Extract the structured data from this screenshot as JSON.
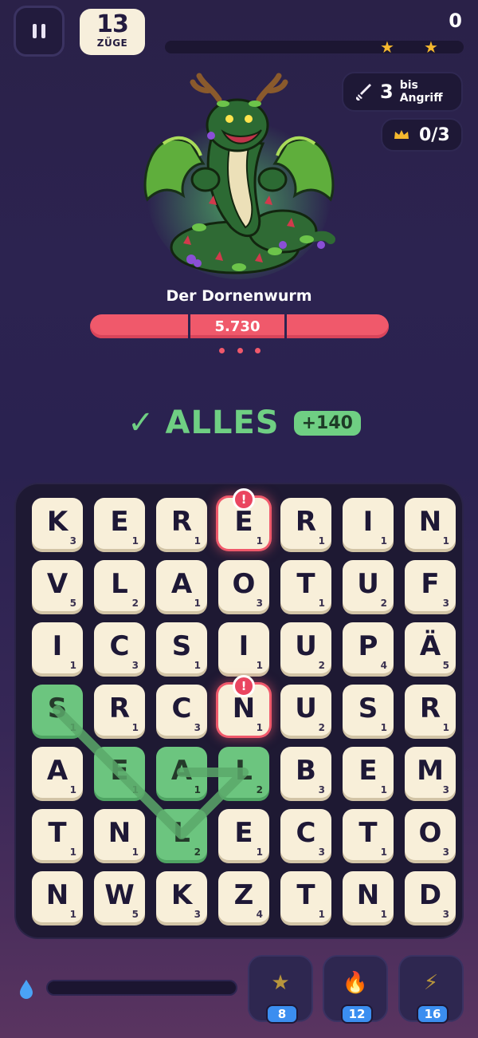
{
  "header": {
    "moves_value": "13",
    "moves_label": "ZÜGE",
    "score": "0"
  },
  "progress": {
    "fill": 0,
    "star_marks": 2
  },
  "attack": {
    "count": "3",
    "label_line1": "bis",
    "label_line2": "Angriff"
  },
  "crowns": {
    "value": "0/3"
  },
  "monster": {
    "name": "Der Dornenwurm",
    "hp": "5.730"
  },
  "result": {
    "word": "ALLES",
    "bonus": "+140"
  },
  "board": {
    "rows": [
      [
        {
          "l": "K",
          "v": "3"
        },
        {
          "l": "E",
          "v": "1"
        },
        {
          "l": "R",
          "v": "1"
        },
        {
          "l": "E",
          "v": "1",
          "warn": true
        },
        {
          "l": "R",
          "v": "1"
        },
        {
          "l": "I",
          "v": "1"
        },
        {
          "l": "N",
          "v": "1"
        }
      ],
      [
        {
          "l": "V",
          "v": "5"
        },
        {
          "l": "L",
          "v": "2"
        },
        {
          "l": "A",
          "v": "1"
        },
        {
          "l": "O",
          "v": "3"
        },
        {
          "l": "T",
          "v": "1"
        },
        {
          "l": "U",
          "v": "2"
        },
        {
          "l": "F",
          "v": "3"
        }
      ],
      [
        {
          "l": "I",
          "v": "1"
        },
        {
          "l": "C",
          "v": "3"
        },
        {
          "l": "S",
          "v": "1"
        },
        {
          "l": "I",
          "v": "1"
        },
        {
          "l": "U",
          "v": "2"
        },
        {
          "l": "P",
          "v": "4"
        },
        {
          "l": "Ä",
          "v": "5"
        }
      ],
      [
        {
          "l": "S",
          "v": "1",
          "sel": true
        },
        {
          "l": "R",
          "v": "1"
        },
        {
          "l": "C",
          "v": "3"
        },
        {
          "l": "N",
          "v": "1",
          "warn": true
        },
        {
          "l": "U",
          "v": "2"
        },
        {
          "l": "S",
          "v": "1"
        },
        {
          "l": "R",
          "v": "1"
        }
      ],
      [
        {
          "l": "A",
          "v": "1"
        },
        {
          "l": "E",
          "v": "1",
          "sel": true
        },
        {
          "l": "A",
          "v": "1",
          "sel": true
        },
        {
          "l": "L",
          "v": "2",
          "sel": true
        },
        {
          "l": "B",
          "v": "3"
        },
        {
          "l": "E",
          "v": "1"
        },
        {
          "l": "M",
          "v": "3"
        }
      ],
      [
        {
          "l": "T",
          "v": "1"
        },
        {
          "l": "N",
          "v": "1"
        },
        {
          "l": "L",
          "v": "2",
          "sel": true
        },
        {
          "l": "E",
          "v": "1"
        },
        {
          "l": "C",
          "v": "3"
        },
        {
          "l": "T",
          "v": "1"
        },
        {
          "l": "O",
          "v": "3"
        }
      ],
      [
        {
          "l": "N",
          "v": "1"
        },
        {
          "l": "W",
          "v": "5"
        },
        {
          "l": "K",
          "v": "3"
        },
        {
          "l": "Z",
          "v": "4"
        },
        {
          "l": "T",
          "v": "1"
        },
        {
          "l": "N",
          "v": "1"
        },
        {
          "l": "D",
          "v": "3"
        }
      ]
    ],
    "warn_badge": "!",
    "path": [
      [
        3,
        0
      ],
      [
        4,
        1
      ],
      [
        5,
        2
      ],
      [
        4,
        3
      ],
      [
        4,
        2
      ]
    ]
  },
  "boosts": [
    {
      "icon": "star-icon",
      "glyph": "★",
      "count": "8"
    },
    {
      "icon": "fire-icon",
      "glyph": "🔥",
      "count": "12"
    },
    {
      "icon": "lightning-icon",
      "glyph": "⚡",
      "count": "16"
    }
  ],
  "colors": {
    "accent_green": "#6fcf83",
    "hp_red": "#f0596b",
    "tile": "#f8efd9",
    "badge_blue": "#3b8ef0"
  }
}
